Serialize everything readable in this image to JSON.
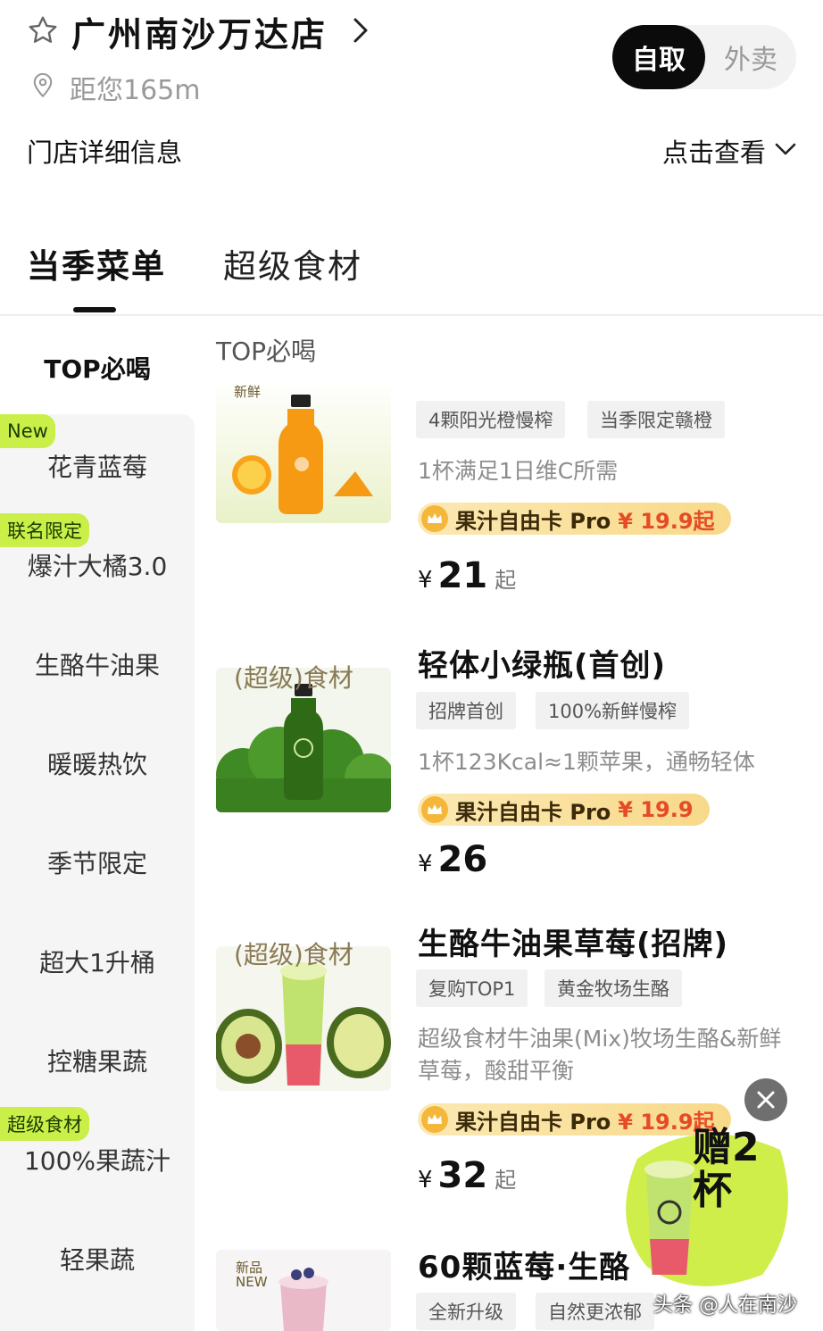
{
  "store": {
    "name": "广州南沙万达店",
    "distance": "距您165m",
    "info_label": "门店详细信息",
    "info_view": "点击查看"
  },
  "mode": {
    "pickup": "自取",
    "delivery": "外卖",
    "selected": "pickup"
  },
  "tabs": [
    {
      "label": "当季菜单",
      "active": true
    },
    {
      "label": "超级食材",
      "active": false
    }
  ],
  "sidebar": {
    "items": [
      {
        "label": "TOP必喝",
        "tag": "",
        "active": true
      },
      {
        "label": "花青蓝莓",
        "tag": "New"
      },
      {
        "label": "爆汁大橘3.0",
        "tag": "联名限定"
      },
      {
        "label": "生酪牛油果",
        "tag": ""
      },
      {
        "label": "暖暖热饮",
        "tag": ""
      },
      {
        "label": "季节限定",
        "tag": ""
      },
      {
        "label": "超大1升桶",
        "tag": ""
      },
      {
        "label": "控糖果蔬",
        "tag": ""
      },
      {
        "label": "100%果蔬汁",
        "tag": "超级食材"
      },
      {
        "label": "轻果蔬",
        "tag": ""
      }
    ]
  },
  "section_title": "TOP必喝",
  "products": [
    {
      "name": "",
      "image_badge": "新鲜",
      "tags": [
        "4颗阳光橙慢榨",
        "当季限定赣橙"
      ],
      "desc": "1杯满足1日维C所需",
      "card_text": "果汁自由卡 Pro",
      "card_price": "¥ 19.9起",
      "price_symbol": "¥",
      "price": "21",
      "price_suffix": "起"
    },
    {
      "name": "轻体小绿瓶(首创)",
      "image_badge": "(超级)食材",
      "tags": [
        "招牌首创",
        "100%新鲜慢榨"
      ],
      "desc": "1杯123Kcal≈1颗苹果，通畅轻体",
      "card_text": "果汁自由卡 Pro",
      "card_price": "¥ 19.9",
      "price_symbol": "¥",
      "price": "26",
      "price_suffix": ""
    },
    {
      "name": "生酪牛油果草莓(招牌)",
      "image_badge": "(超级)食材",
      "tags": [
        "复购TOP1",
        "黄金牧场生酪"
      ],
      "desc_lines": [
        "超级食材牛油果(Mix)牧场生酪&新鲜",
        "草莓，酸甜平衡"
      ],
      "card_text": "果汁自由卡 Pro",
      "card_price": "¥ 19.9起",
      "price_symbol": "¥",
      "price": "32",
      "price_suffix": "起"
    },
    {
      "name": "60颗蓝莓·生酪",
      "image_badge": "新品 NEW",
      "tags": [
        "全新升级",
        "自然更浓郁"
      ]
    }
  ],
  "promo": {
    "text": "赠2杯"
  },
  "watermark": "头条 @人在南沙",
  "colors": {
    "accent_green": "#c9ef48",
    "price_red": "#e54b27",
    "card_gold": "#f8d98a",
    "dark": "#0b0b0b"
  }
}
